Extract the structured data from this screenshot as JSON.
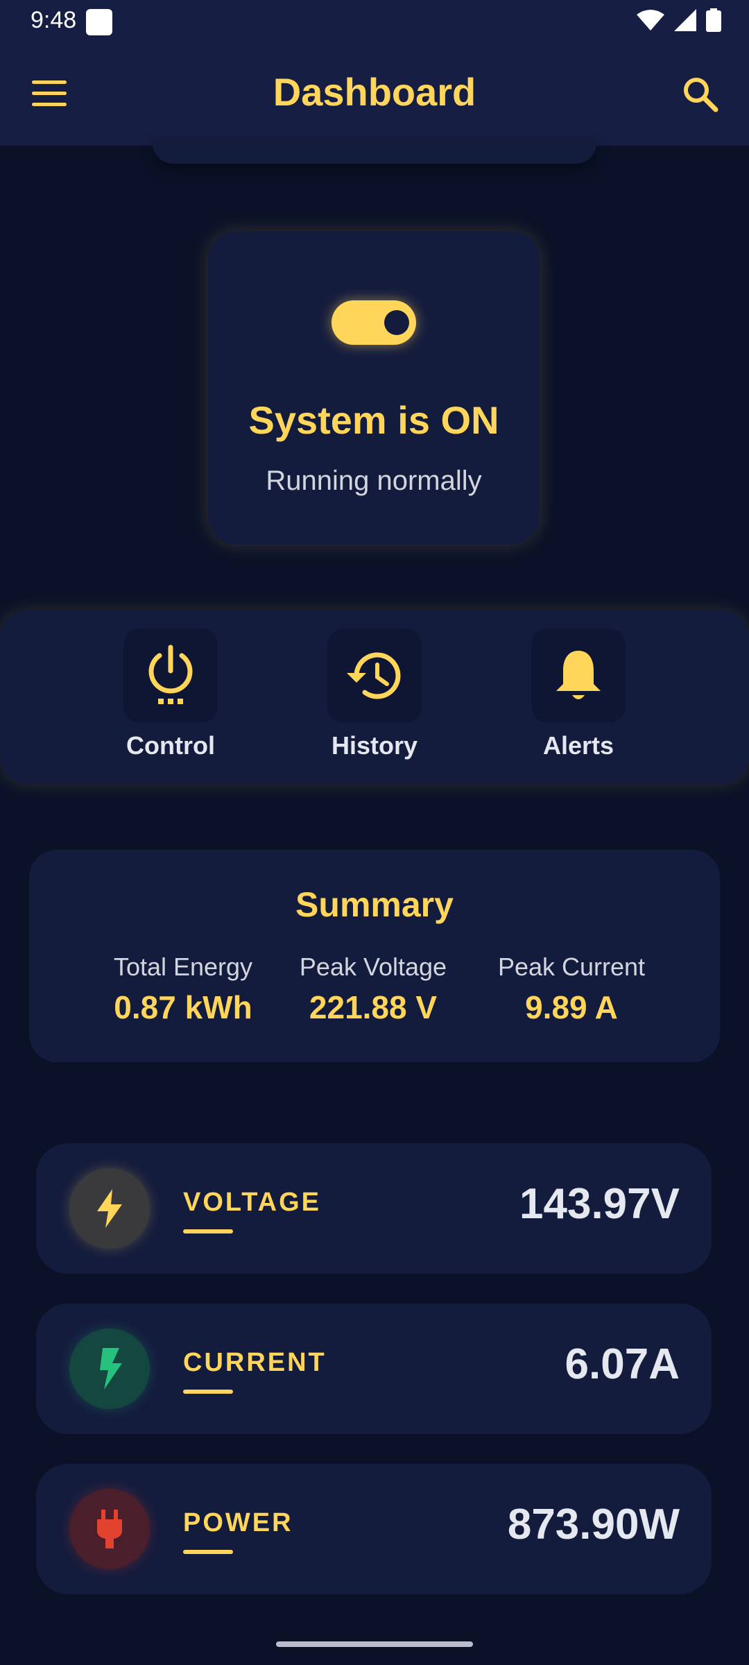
{
  "status_bar": {
    "time": "9:48"
  },
  "app_bar": {
    "title": "Dashboard"
  },
  "system": {
    "state_title": "System is ON",
    "state_sub": "Running normally",
    "toggle_on": true
  },
  "actions": [
    {
      "label": "Control",
      "icon": "power-icon"
    },
    {
      "label": "History",
      "icon": "history-icon"
    },
    {
      "label": "Alerts",
      "icon": "bell-icon"
    }
  ],
  "summary": {
    "title": "Summary",
    "items": [
      {
        "label": "Total Energy",
        "value": "0.87 kWh"
      },
      {
        "label": "Peak Voltage",
        "value": "221.88 V"
      },
      {
        "label": "Peak Current",
        "value": "9.89 A"
      }
    ]
  },
  "metrics": [
    {
      "name": "VOLTAGE",
      "value": "143.97V",
      "icon": "bolt-icon",
      "color": "#ffd65a"
    },
    {
      "name": "CURRENT",
      "value": "6.07A",
      "icon": "flash-icon",
      "color": "#27c17e"
    },
    {
      "name": "POWER",
      "value": "873.90W",
      "icon": "plug-icon",
      "color": "#e2432f"
    }
  ],
  "colors": {
    "accent": "#ffd65a",
    "background": "#0b1228",
    "card": "#141c3d"
  }
}
